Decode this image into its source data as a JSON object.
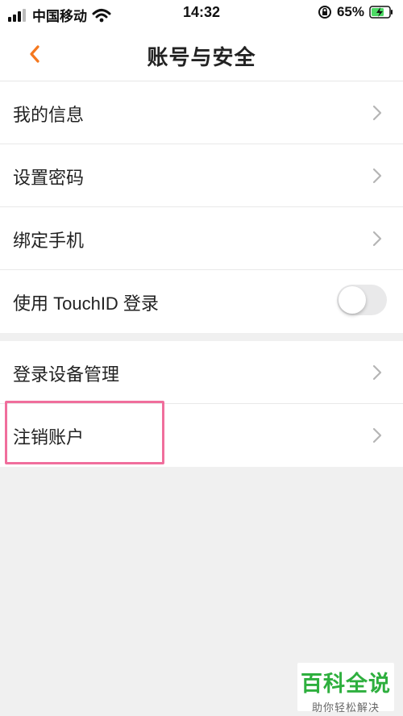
{
  "status_bar": {
    "carrier": "中国移动",
    "time": "14:32",
    "battery": "65%"
  },
  "header": {
    "title": "账号与安全"
  },
  "section1": {
    "items": [
      {
        "label": "我的信息",
        "icon": "chevron-right-icon"
      },
      {
        "label": "设置密码",
        "icon": "chevron-right-icon"
      },
      {
        "label": "绑定手机",
        "icon": "chevron-right-icon"
      },
      {
        "label": "使用 TouchID 登录",
        "toggle": false
      }
    ]
  },
  "section2": {
    "items": [
      {
        "label": "登录设备管理",
        "icon": "chevron-right-icon"
      },
      {
        "label": "注销账户",
        "icon": "chevron-right-icon"
      }
    ]
  },
  "watermark": {
    "title": "百科全说",
    "subtitle": "助你轻松解决"
  },
  "colors": {
    "accent": "#f5781e",
    "highlight": "#f06e9c",
    "watermark": "#2eaf3e"
  }
}
